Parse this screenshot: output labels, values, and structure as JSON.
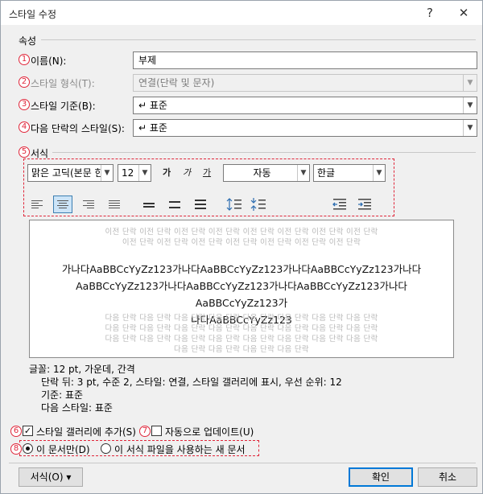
{
  "window": {
    "title": "스타일 수정",
    "help_label": "?",
    "close_label": "✕"
  },
  "properties": {
    "section_title": "속성",
    "name": {
      "badge": "1",
      "label": "이름(N):",
      "value": "부제"
    },
    "style_type": {
      "badge": "2",
      "label": "스타일 형식(T):",
      "value": "연결(단락 및 문자)"
    },
    "style_based_on": {
      "badge": "3",
      "label": "스타일 기준(B):",
      "value": "↵ 표준"
    },
    "next_style": {
      "badge": "4",
      "label": "다음 단락의 스타일(S):",
      "value": "↵ 표준"
    }
  },
  "format": {
    "badge": "5",
    "section_title": "서식",
    "font": "맑은 고딕(본문 한",
    "size": "12",
    "bold": "가",
    "italic": "가",
    "underline": "가",
    "color": "자동",
    "script": "한글"
  },
  "preview": {
    "prev_paragraph": [
      "이전 단락 이전 단락 이전 단락 이전 단락 이전 단락 이전 단락 이전 단락 이전 단락",
      "이전 단락 이전 단락 이전 단락 이전 단락 이전 단락 이전 단락 이전 단락"
    ],
    "sample_lines": [
      "가나다AaBBCcYyZz123가나다AaBBCcYyZz123가나다AaBBCcYyZz123가나다",
      "AaBBCcYyZz123가나다AaBBCcYyZz123가나다AaBBCcYyZz123가나다AaBBCcYyZz123가",
      "나다AaBBCcYyZz123"
    ],
    "next_paragraph": [
      "다음 단락 다음 단락 다음 단락 다음 단락 다음 단락 다음 단락 다음 단락 다음 단락",
      "다음 단락 다음 단락 다음 단락 다음 단락 다음 단락 다음 단락 다음 단락 다음 단락",
      "다음 단락 다음 단락 다음 단락 다음 단락 다음 단락 다음 단락 다음 단락 다음 단락",
      "다음 단락 다음 단락 다음 단락 다음 단락"
    ]
  },
  "description": {
    "line1": "글꼴: 12 pt, 가운데, 간격",
    "line2": "단락 뒤: 3 pt, 수준 2, 스타일: 연결, 스타일 갤러리에 표시, 우선 순위: 12",
    "line3": "기준: 표준",
    "line4": "다음 스타일: 표준"
  },
  "options": {
    "add_to_gallery": {
      "badge": "6",
      "label": "스타일 갤러리에 추가(S)",
      "checked": true,
      "mark": "✓"
    },
    "auto_update": {
      "badge": "7",
      "label": "자동으로 업데이트(U)",
      "checked": false
    },
    "scope_badge": "8",
    "only_this_doc": {
      "label": "이 문서만(D)",
      "selected": true
    },
    "new_docs": {
      "label": "이 서식 파일을 사용하는 새 문서",
      "selected": false
    }
  },
  "buttons": {
    "format_menu": "서식(O) ▾",
    "ok": "확인",
    "cancel": "취소"
  },
  "colors": {
    "accent_red": "#e0263a",
    "primary_blue": "#0078d7"
  }
}
